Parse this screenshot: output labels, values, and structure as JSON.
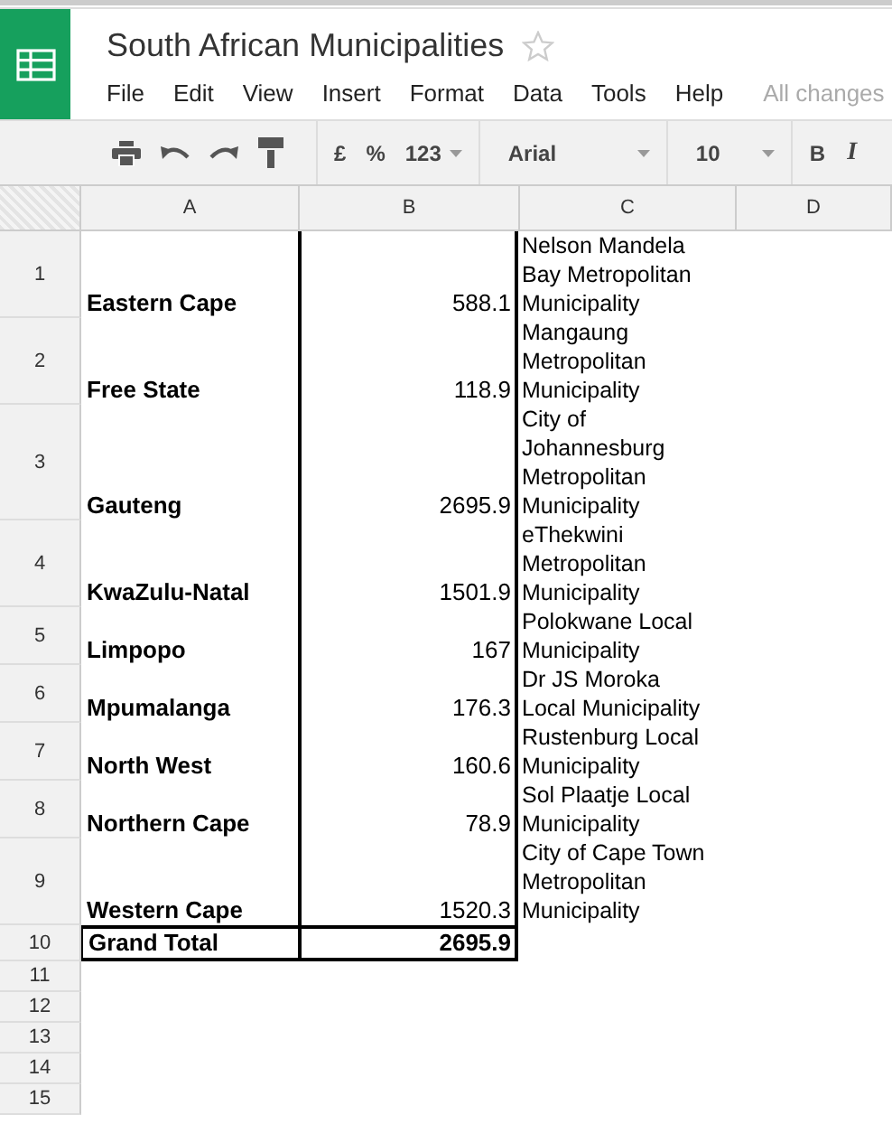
{
  "document": {
    "title": "South African Municipalities",
    "starred": false
  },
  "menu": [
    "File",
    "Edit",
    "View",
    "Insert",
    "Format",
    "Data",
    "Tools",
    "Help"
  ],
  "save_status": "All changes",
  "toolbar": {
    "currency": "£",
    "percent": "%",
    "number_format": "123",
    "font": "Arial",
    "font_size": "10",
    "bold": "B",
    "italic": "I"
  },
  "columns": [
    "A",
    "B",
    "C",
    "D"
  ],
  "rows": [
    {
      "number": "1",
      "kind": "data",
      "a": "Eastern Cape",
      "b": "588.1",
      "c": "Nelson Mandela\nBay Metropolitan\nMunicipality"
    },
    {
      "number": "2",
      "kind": "data",
      "a": "Free State",
      "b": "118.9",
      "c": "Mangaung\nMetropolitan\nMunicipality"
    },
    {
      "number": "3",
      "kind": "data",
      "a": "Gauteng",
      "b": "2695.9",
      "c": "City of\nJohannesburg\nMetropolitan\nMunicipality"
    },
    {
      "number": "4",
      "kind": "data",
      "a": "KwaZulu-Natal",
      "b": "1501.9",
      "c": "eThekwini\nMetropolitan\nMunicipality"
    },
    {
      "number": "5",
      "kind": "data",
      "a": "Limpopo",
      "b": "167",
      "c": "Polokwane Local\nMunicipality"
    },
    {
      "number": "6",
      "kind": "data",
      "a": "Mpumalanga",
      "b": "176.3",
      "c": "Dr JS Moroka\nLocal Municipality"
    },
    {
      "number": "7",
      "kind": "data",
      "a": "North West",
      "b": "160.6",
      "c": "Rustenburg Local\nMunicipality"
    },
    {
      "number": "8",
      "kind": "data",
      "a": "Northern Cape",
      "b": "78.9",
      "c": "Sol Plaatje Local\nMunicipality"
    },
    {
      "number": "9",
      "kind": "data",
      "a": "Western Cape",
      "b": "1520.3",
      "c": "City of Cape Town\nMetropolitan\nMunicipality"
    },
    {
      "number": "10",
      "kind": "total",
      "a": "Grand Total",
      "b": "2695.9"
    },
    {
      "number": "11",
      "kind": "empty"
    },
    {
      "number": "12",
      "kind": "empty"
    },
    {
      "number": "13",
      "kind": "empty"
    },
    {
      "number": "14",
      "kind": "empty"
    },
    {
      "number": "15",
      "kind": "empty"
    }
  ]
}
